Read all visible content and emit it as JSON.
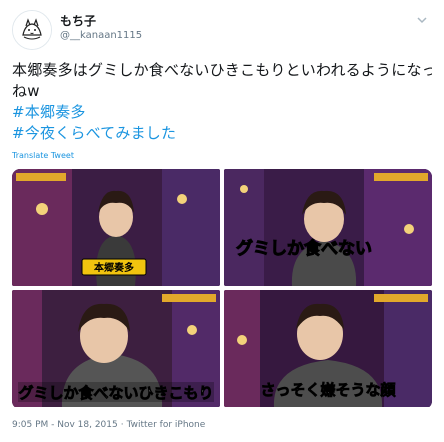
{
  "user": {
    "display_name": "もち子",
    "handle": "@__kanaan1115"
  },
  "tweet": {
    "text_line1": "本郷奏多はグミしか食べないひきこもりといわれるようになったん",
    "text_line2": "ねw",
    "hashtags": [
      "#本郷奏多",
      "#今夜くらべてみました"
    ],
    "translate_label": "Translate Tweet"
  },
  "media": {
    "captions": {
      "top_right": "グミしか食べない",
      "bottom_left": "グミしか食べないひきこもり",
      "bottom_right": "さっそく嫌そうな顔",
      "top_left_nameplate": "本郷奏多"
    }
  },
  "footer": {
    "timestamp": "9:05 PM - Nov 18, 2015",
    "client": "Twitter for iPhone"
  },
  "colors": {
    "link": "#1b95e0",
    "secondary_text": "#657786",
    "stage_purple": "#5b2a6e",
    "stage_gold": "#e2a82b"
  }
}
